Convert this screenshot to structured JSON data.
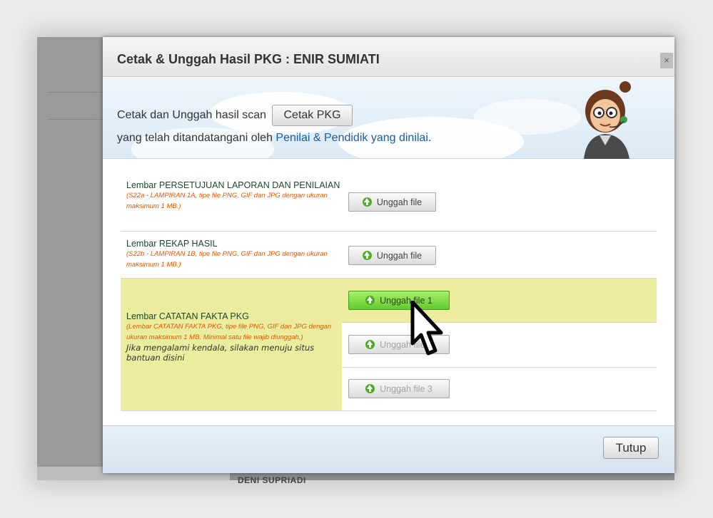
{
  "dialog": {
    "title": "Cetak & Unggah Hasil PKG : ENIR SUMIATI",
    "close_label": "×",
    "intro": {
      "line1": "Cetak dan Unggah hasil scan",
      "print_button": "Cetak PKG",
      "line2_prefix": "yang telah ditandatangani oleh ",
      "line2_link": "Penilai & Pendidik yang dinilai",
      "line2_suffix": "."
    },
    "rows": [
      {
        "title": "Lembar PERSETUJUAN LAPORAN DAN PENILAIAN",
        "note": "(S22a - LAMPIRAN 1A, tipe file PNG, GIF dan JPG dengan ukuran maksimum 1 MB.)",
        "buttons": [
          "Unggah file"
        ]
      },
      {
        "title": "Lembar REKAP HASIL",
        "note": "(S22b - LAMPIRAN 1B, tipe file PNG, GIF dan JPG dengan ukuran maksimum 1 MB.)",
        "buttons": [
          "Unggah file"
        ]
      },
      {
        "title": "Lembar CATATAN FAKTA PKG",
        "note": "(Lembar CATATAN FAKTA PKG, tipe file PNG, GIF dan JPG dengan ukuran maksimum 1 MB. Minimal satu file wajib diunggah.)",
        "help": "Jika mengalami kendala, silakan menuju situs bantuan disini",
        "buttons": [
          "Unggah file 1",
          "Unggah file 2",
          "Unggah file 3"
        ]
      }
    ],
    "footer": {
      "close_button": "Tutup"
    }
  },
  "background": {
    "name_text": "DENI SUPRIADI"
  },
  "colors": {
    "highlight_row": "#ecec9e",
    "active_button": "#7fd843",
    "link": "#1a5aa5",
    "note": "#e05a00"
  },
  "icons": {
    "upload": "upload-arrow-icon",
    "close": "close-icon",
    "cursor": "hand-pointer-icon"
  }
}
